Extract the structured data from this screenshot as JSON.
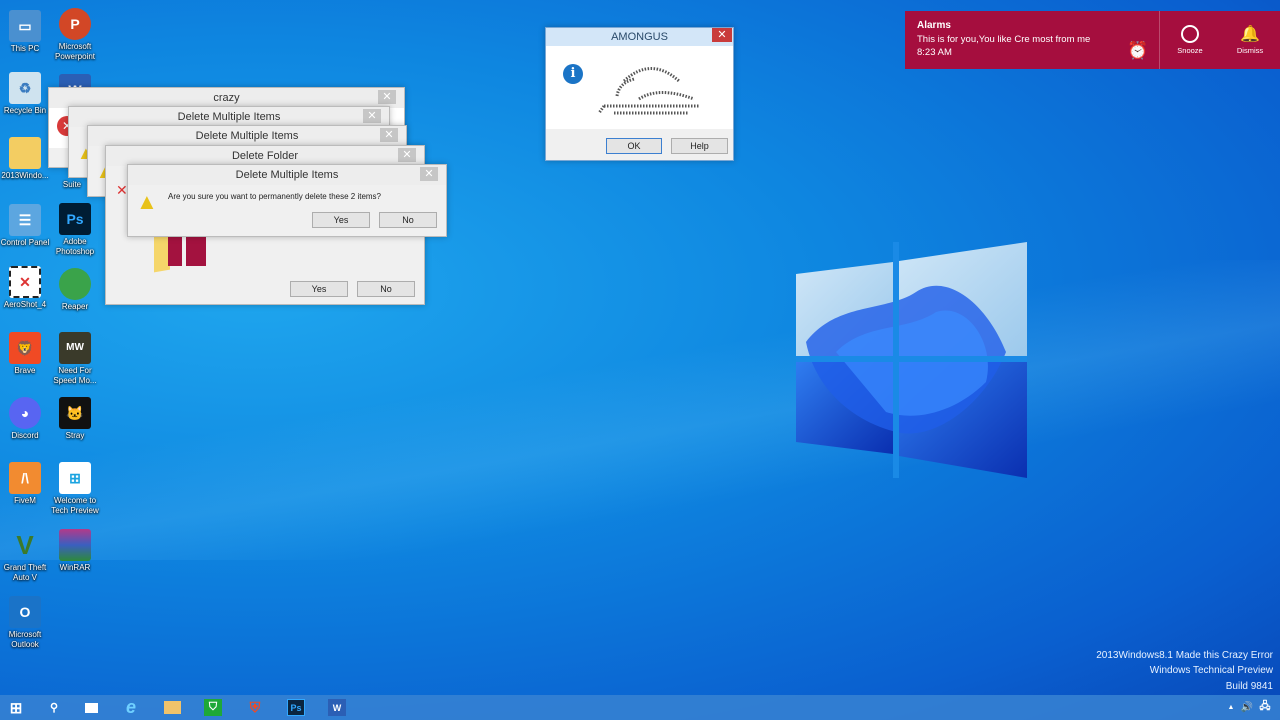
{
  "desktop": {
    "icons_col1": [
      "This PC",
      "Recycle Bin",
      "2013Windo...",
      "Control Panel",
      "AeroShot_4",
      "Brave",
      "Discord",
      "FiveM",
      "Grand Theft Auto V",
      "Microsoft Outlook"
    ],
    "icons_col2": [
      "Microsoft Powerpoint",
      "",
      "Suite",
      "Adobe Photoshop",
      "Reaper",
      "Need For Speed Mo...",
      "Stray",
      "Welcome to Tech Preview",
      "WinRAR"
    ]
  },
  "dialogs": {
    "d1": {
      "title": "crazy"
    },
    "d2": {
      "title": "Delete Multiple Items"
    },
    "d3": {
      "title": "Delete Multiple Items"
    },
    "d4": {
      "title": "Delete Folder",
      "yes": "Yes",
      "no": "No"
    },
    "d5": {
      "title": "Delete Multiple Items",
      "message": "Are you sure you want to permanently delete these 2 items?",
      "yes": "Yes",
      "no": "No"
    }
  },
  "amongus": {
    "title": "AMONGUS",
    "ok": "OK",
    "help": "Help"
  },
  "toast": {
    "app": "Alarms",
    "message": "This is for you,You like Cre most from me",
    "time": "8:23 AM",
    "snooze": "Snooze",
    "dismiss": "Dismiss"
  },
  "watermark": {
    "line1": "2013Windows8.1 Made this Crazy Error",
    "line2": "Windows Technical Preview",
    "line3": "Build 9841"
  },
  "taskbar": {
    "ps": "Ps",
    "word": "W"
  },
  "colors": {
    "toast": "#a50e3e",
    "taskbar": "#3782d2"
  }
}
